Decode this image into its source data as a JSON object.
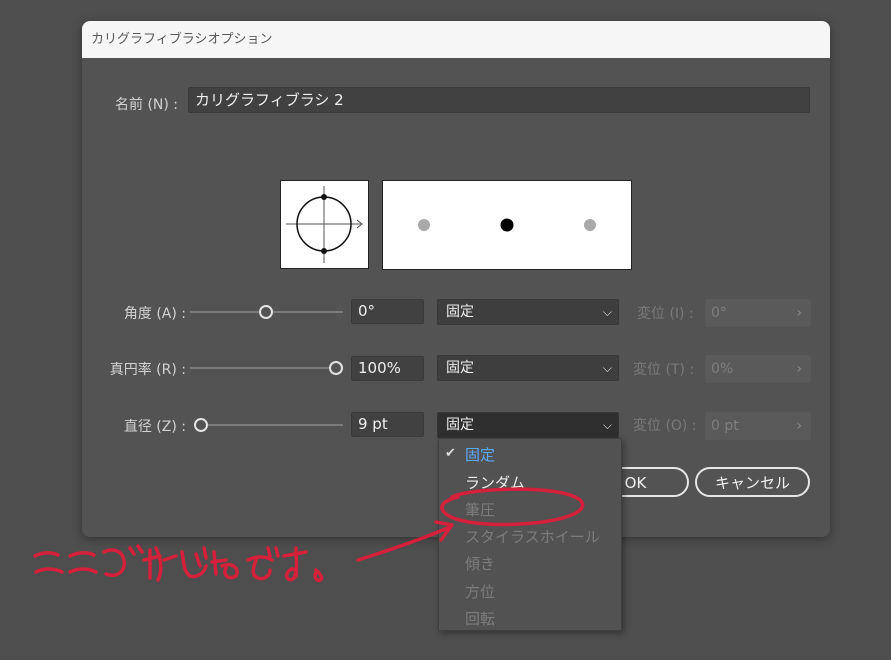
{
  "dialog": {
    "title": "カリグラフィブラシオプション",
    "name_label": "名前 (N) :",
    "name_value": "カリグラフィブラシ 2",
    "rows": [
      {
        "label": "角度 (A) :",
        "value": "0°",
        "select": "固定",
        "var_label": "変位 (I) :",
        "var_value": "0°",
        "slider_fraction": 0.5
      },
      {
        "label": "真円率 (R) :",
        "value": "100%",
        "select": "固定",
        "var_label": "変位 (T) :",
        "var_value": "0%",
        "slider_fraction": 1.0
      },
      {
        "label": "直径 (Z) :",
        "value": "9 pt",
        "select": "固定",
        "var_label": "変位 (O) :",
        "var_value": "0 pt",
        "slider_fraction": 0.0
      }
    ],
    "ok_label": "OK",
    "cancel_label": "キャンセル"
  },
  "dropdown": {
    "items": [
      {
        "label": "固定",
        "state": "selected"
      },
      {
        "label": "ランダム",
        "state": "enabled"
      },
      {
        "label": "筆圧",
        "state": "disabled"
      },
      {
        "label": "スタイラスホイール",
        "state": "disabled"
      },
      {
        "label": "傾き",
        "state": "disabled"
      },
      {
        "label": "方位",
        "state": "disabled"
      },
      {
        "label": "回転",
        "state": "disabled"
      }
    ]
  },
  "annotation": {
    "color": "#d4203a"
  },
  "icons": {
    "check": "checkmark-icon",
    "chevron": "chevron-down-icon",
    "var_arrow": "chevron-right-icon"
  }
}
